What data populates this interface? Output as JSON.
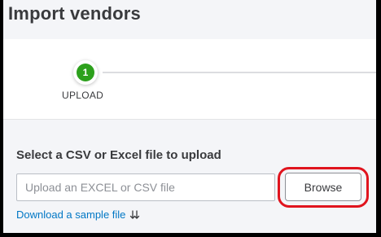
{
  "page": {
    "title": "Import vendors"
  },
  "stepper": {
    "steps": [
      {
        "number": "1",
        "label": "UPLOAD",
        "active": true
      }
    ],
    "accent_color": "#2ca01c"
  },
  "upload": {
    "section_label": "Select a CSV or Excel file to upload",
    "input_placeholder": "Upload an EXCEL or CSV file",
    "browse_label": "Browse",
    "sample_link": "Download a sample file",
    "sample_icon": "download-arrows-icon",
    "link_color": "#0077c5",
    "highlight_color": "#e0141e"
  }
}
